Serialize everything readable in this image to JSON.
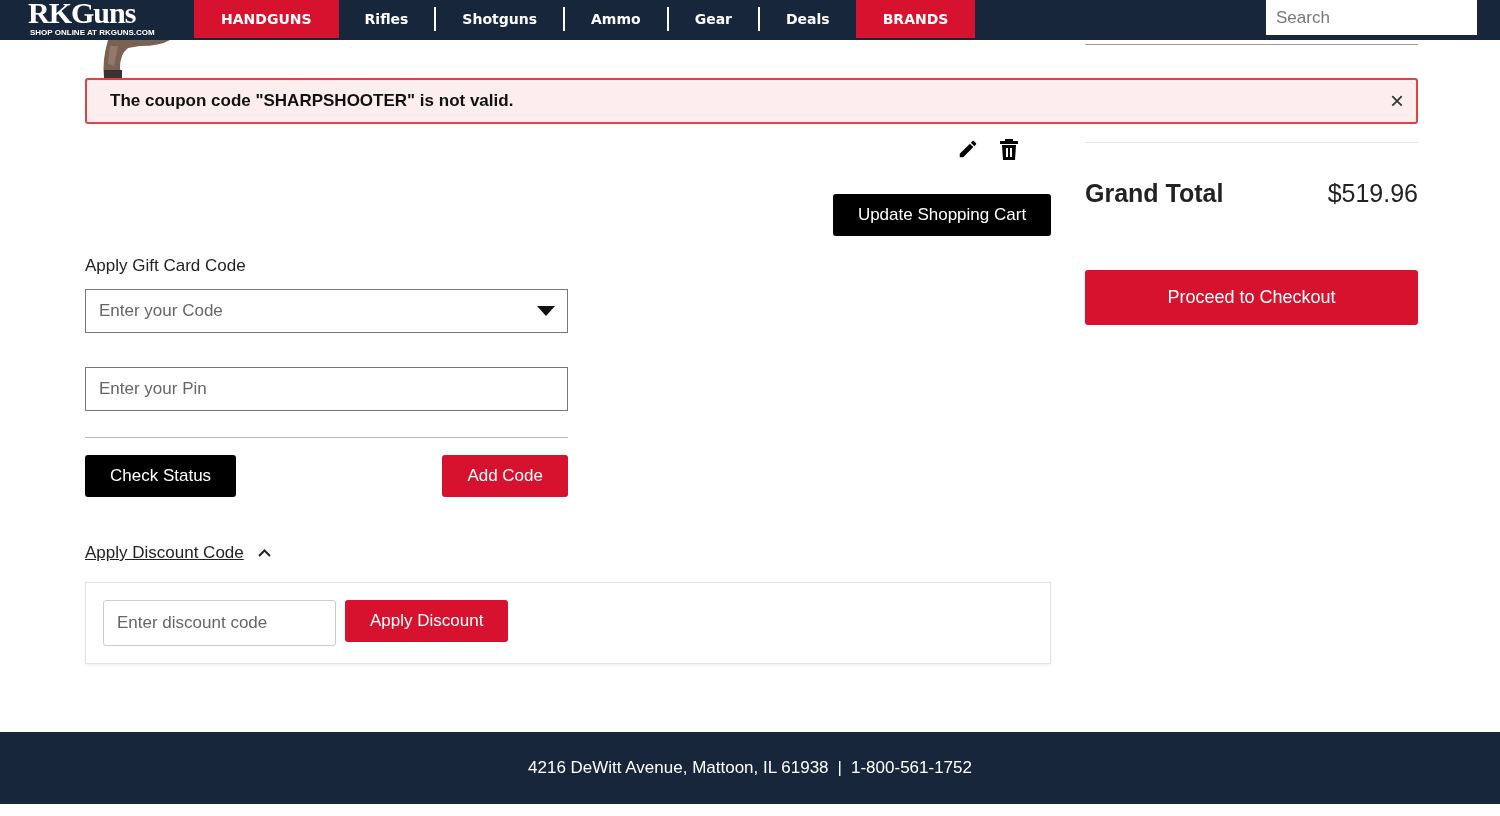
{
  "header": {
    "logo": {
      "name": "RKGuns",
      "tagline": "SHOP ONLINE AT RKGUNS.COM"
    },
    "nav": [
      {
        "label": "HANDGUNS",
        "highlighted": true
      },
      {
        "label": "Rifles",
        "highlighted": false
      },
      {
        "label": "Shotguns",
        "highlighted": false
      },
      {
        "label": "Ammo",
        "highlighted": false
      },
      {
        "label": "Gear",
        "highlighted": false
      },
      {
        "label": "Deals",
        "highlighted": false
      },
      {
        "label": "BRANDS",
        "highlighted": true
      }
    ],
    "search": {
      "placeholder": "Search"
    }
  },
  "alert": {
    "message": "The coupon code \"SHARPSHOOTER\" is not valid.",
    "close": "×"
  },
  "cart": {
    "update_button": "Update Shopping Cart"
  },
  "gift_card": {
    "title": "Apply Gift Card Code",
    "code_field": {
      "placeholder": "Enter your Code"
    },
    "pin_field": {
      "placeholder": "Enter your Pin"
    },
    "check_button": "Check Status",
    "add_button": "Add Code"
  },
  "discount": {
    "title": "Apply Discount Code",
    "expanded": true,
    "field": {
      "placeholder": "Enter discount code"
    },
    "apply_button": "Apply Discount"
  },
  "summary": {
    "grand_total_label": "Grand Total",
    "grand_total": "$519.96",
    "checkout_button": "Proceed to Checkout"
  },
  "footer": {
    "address": "4216 DeWitt Avenue, Mattoon, IL 61938",
    "separator": "|",
    "phone": "1-800-561-1752"
  }
}
